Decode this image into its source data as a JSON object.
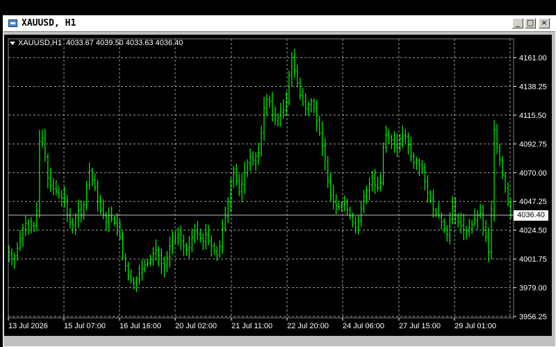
{
  "window": {
    "title": "XAUUSD, H1",
    "buttons": {
      "minimize": "_",
      "maximize": "□",
      "close": "×"
    }
  },
  "header": {
    "symbol": "XAUUSD,H1",
    "ohlc": "4033.67 4039.50 4033.63 4036.40"
  },
  "current_price": "4036.40",
  "colors": {
    "bar": "#00ff00",
    "grid": "#a0a0a0",
    "background": "#000000",
    "text": "#ffffff"
  },
  "chart_data": {
    "type": "ohlc",
    "price_ticks": [
      "4161.00",
      "4138.25",
      "4115.50",
      "4092.75",
      "4070.00",
      "4047.25",
      "4024.50",
      "4001.75",
      "3979.00",
      "3956.25"
    ],
    "time_ticks": [
      "13 Jul 2026",
      "15 Jul 07:00",
      "16 Jul 16:00",
      "20 Jul 02:00",
      "21 Jul 11:00",
      "22 Jul 20:00",
      "24 Jul 06:00",
      "27 Jul 15:00",
      "29 Jul 01:00"
    ],
    "ylim": [
      3956.25,
      4161.0
    ],
    "grid": true,
    "close_series": [
      4007,
      4002,
      4004,
      4010,
      4018,
      4026,
      4030,
      4031,
      4027,
      4028,
      4040,
      4095,
      4098,
      4083,
      4066,
      4060,
      4057,
      4055,
      4052,
      4050,
      4047,
      4036,
      4031,
      4029,
      4034,
      4040,
      4037,
      4045,
      4060,
      4071,
      4064,
      4058,
      4047,
      4040,
      4037,
      4031,
      4036,
      4034,
      4030,
      4028,
      4019,
      4003,
      3996,
      3988,
      3985,
      3983,
      3986,
      3990,
      3994,
      3997,
      3999,
      4001,
      4006,
      4009,
      4004,
      3998,
      3996,
      4003,
      4012,
      4015,
      4018,
      4021,
      4016,
      4012,
      4009,
      4011,
      4019,
      4024,
      4022,
      4018,
      4016,
      4021,
      4016,
      4012,
      4008,
      4005,
      4012,
      4026,
      4035,
      4047,
      4063,
      4073,
      4063,
      4055,
      4061,
      4070,
      4078,
      4082,
      4080,
      4083,
      4086,
      4101,
      4121,
      4128,
      4126,
      4116,
      4112,
      4114,
      4118,
      4120,
      4126,
      4147,
      4161,
      4151,
      4141,
      4131,
      4126,
      4121,
      4124,
      4127,
      4121,
      4111,
      4101,
      4091,
      4080,
      4064,
      4052,
      4047,
      4044,
      4043,
      4045,
      4046,
      4041,
      4036,
      4031,
      4026,
      4031,
      4041,
      4051,
      4056,
      4061,
      4066,
      4060,
      4058,
      4062,
      4090,
      4100,
      4098,
      4096,
      4093,
      4090,
      4097,
      4099,
      4098,
      4092,
      4083,
      4078,
      4080,
      4076,
      4073,
      4063,
      4054,
      4048,
      4041,
      4038,
      4036,
      4031,
      4026,
      4021,
      4033,
      4043,
      4036,
      4031,
      4028,
      4025,
      4024,
      4026,
      4029,
      4033,
      4036,
      4038,
      4026,
      4019,
      4007,
      4041,
      4104,
      4090,
      4080,
      4068,
      4058,
      4046,
      4036
    ]
  }
}
